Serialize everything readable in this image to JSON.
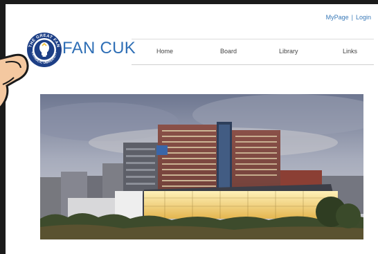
{
  "header": {
    "mypage_label": "MyPage",
    "separator": "|",
    "login_label": "Login",
    "brand": "FAN CUK"
  },
  "nav": {
    "items": [
      {
        "label": "Home"
      },
      {
        "label": "Board"
      },
      {
        "label": "Library"
      },
      {
        "label": "Links"
      }
    ]
  },
  "logo": {
    "ring_text_top": "THE GREAT FAN",
    "ring_text_bottom": "CATHOLIC UNIVERSITY"
  },
  "colors": {
    "brand": "#2f6fb6",
    "link": "#3a7ab8",
    "logo_navy": "#1d3f86"
  },
  "icons": {
    "logo": "university-seal-logo",
    "pointer": "hand-pointer-icon",
    "hero": "campus-building-photo"
  }
}
